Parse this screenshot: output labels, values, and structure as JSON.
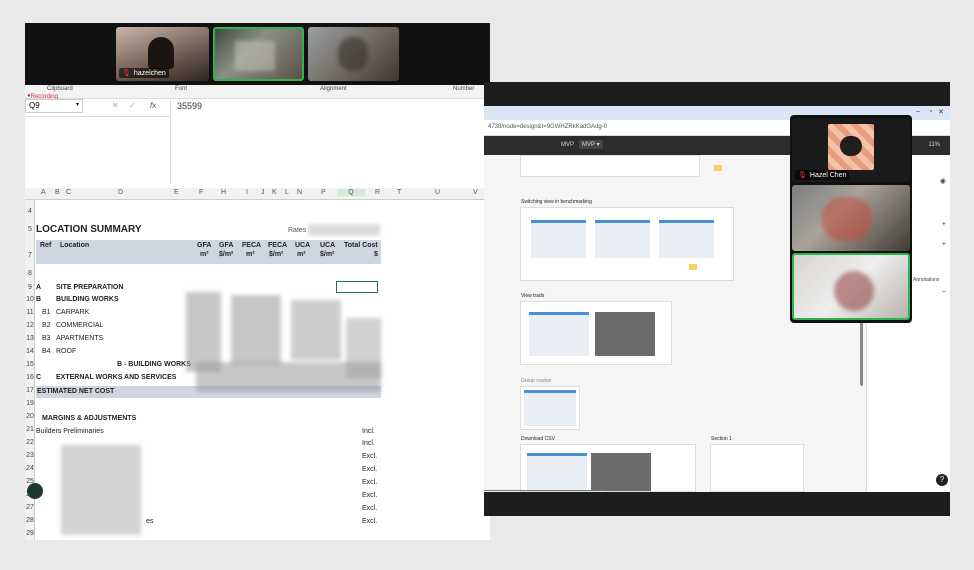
{
  "meeting": {
    "participants": [
      {
        "name": "hazelchen"
      },
      {
        "name": ""
      },
      {
        "name": ""
      }
    ],
    "floating_participant_name": "Hazel Chen"
  },
  "spreadsheet": {
    "ribbon_groups": [
      "Clipboard",
      "Font",
      "Alignment",
      "Number"
    ],
    "recording_label": "Recording",
    "name_box": "Q9",
    "formula_value": "35599",
    "columns": [
      "A",
      "B",
      "C",
      "D",
      "E",
      "F",
      "H",
      "I",
      "J",
      "K",
      "L",
      "N",
      "P",
      "Q",
      "R",
      "T",
      "U",
      "V"
    ],
    "rows": [
      "4",
      "5",
      "7",
      "8",
      "9",
      "10",
      "11",
      "12",
      "13",
      "14",
      "15",
      "16",
      "17",
      "19",
      "20",
      "21",
      "22",
      "23",
      "24",
      "25",
      "26",
      "27",
      "28",
      "29",
      "30"
    ],
    "title": "LOCATION SUMMARY",
    "rates_label": "Rates",
    "headers": {
      "ref": "Ref",
      "location": "Location",
      "gfa_m2": "GFA",
      "gfa_m2_unit": "m²",
      "gfa_sm2": "GFA",
      "gfa_sm2_unit": "$/m²",
      "feca_m2": "FECA",
      "feca_m2_unit": "m²",
      "feca_sm2": "FECA",
      "feca_sm2_unit": "$/m²",
      "uca_m2": "UCA",
      "uca_m2_unit": "m²",
      "uca_sm2": "UCA",
      "uca_sm2_unit": "$/m²",
      "total": "Total Cost",
      "total_unit": "$"
    },
    "lines": {
      "a_ref": "A",
      "a_label": "SITE PREPARATION",
      "b_ref": "B",
      "b_label": "BUILDING WORKS",
      "b1_ref": "B1",
      "b1_label": "CARPARK",
      "b2_ref": "B2",
      "b2_label": "COMMERCIAL",
      "b3_ref": "B3",
      "b3_label": "APARTMENTS",
      "b4_ref": "B4",
      "b4_label": "ROOF",
      "b_subtotal": "B - BUILDING WORKS",
      "c_ref": "C",
      "c_label": "EXTERNAL WORKS AND SERVICES",
      "net_cost": "ESTIMATED NET COST",
      "margins": "MARGINS & ADJUSTMENTS",
      "prelims": "Builders Preliminaries",
      "ges": "es"
    },
    "statuses": [
      "Incl.",
      "Incl.",
      "Excl.",
      "Excl.",
      "Excl.",
      "Excl.",
      "Excl.",
      "Excl."
    ]
  },
  "design_tool": {
    "url": "4738/node=design&t=9GWHZRkKadGAdg-0",
    "toolbar_left": "MVP",
    "toolbar_mid": "MVP",
    "zoom": "11%",
    "frames": [
      {
        "label": "Switching view in benchmarking"
      },
      {
        "label": "View trads"
      },
      {
        "label": "Group navbar"
      },
      {
        "label": "Download CSV"
      },
      {
        "label": "Section 1"
      }
    ],
    "panel_text": "Annotations"
  },
  "help_icon": "?"
}
